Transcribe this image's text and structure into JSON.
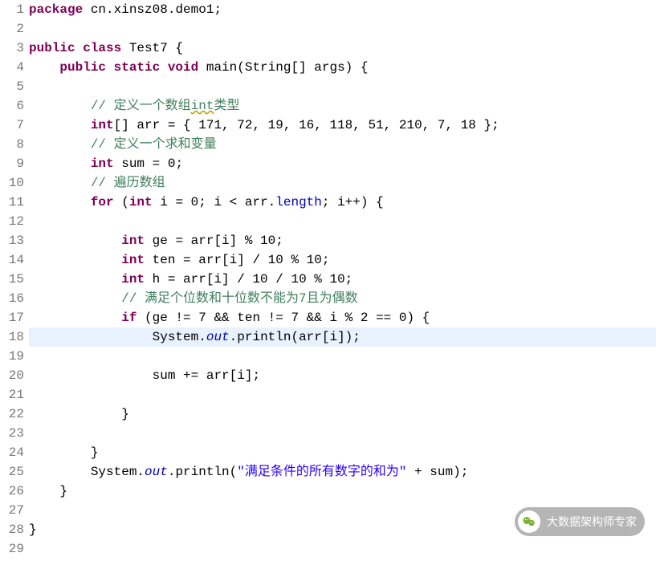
{
  "lines": [
    {
      "n": 1,
      "t": [
        [
          "kw",
          "package"
        ],
        [
          "",
          " cn.xinsz08.demo1;"
        ]
      ]
    },
    {
      "n": 2,
      "t": [
        [
          "",
          ""
        ]
      ]
    },
    {
      "n": 3,
      "t": [
        [
          "kw",
          "public class"
        ],
        [
          "",
          " Test7 {"
        ]
      ]
    },
    {
      "n": 4,
      "t": [
        [
          "",
          "    "
        ],
        [
          "kw",
          "public static void"
        ],
        [
          "",
          " main(String[] args) {"
        ]
      ]
    },
    {
      "n": 5,
      "t": [
        [
          "",
          ""
        ]
      ]
    },
    {
      "n": 6,
      "t": [
        [
          "",
          "        "
        ],
        [
          "cmt",
          "// 定义一个数组"
        ],
        [
          "cmtkw",
          "int"
        ],
        [
          "cmt",
          "类型"
        ]
      ]
    },
    {
      "n": 7,
      "t": [
        [
          "",
          "        "
        ],
        [
          "kw",
          "int"
        ],
        [
          "",
          "[] arr = { 171, 72, 19, 16, 118, 51, 210, 7, 18 };"
        ]
      ]
    },
    {
      "n": 8,
      "t": [
        [
          "",
          "        "
        ],
        [
          "cmt",
          "// 定义一个求和变量"
        ]
      ]
    },
    {
      "n": 9,
      "t": [
        [
          "",
          "        "
        ],
        [
          "kw",
          "int"
        ],
        [
          "",
          " sum = 0;"
        ]
      ]
    },
    {
      "n": 10,
      "t": [
        [
          "",
          "        "
        ],
        [
          "cmt",
          "// 遍历数组"
        ]
      ]
    },
    {
      "n": 11,
      "t": [
        [
          "",
          "        "
        ],
        [
          "kw",
          "for"
        ],
        [
          "",
          " ("
        ],
        [
          "kw",
          "int"
        ],
        [
          "",
          " i = 0; i < arr."
        ],
        [
          "fld",
          "length"
        ],
        [
          "",
          "; i++) {"
        ]
      ]
    },
    {
      "n": 12,
      "t": [
        [
          "",
          ""
        ]
      ]
    },
    {
      "n": 13,
      "t": [
        [
          "",
          "            "
        ],
        [
          "kw",
          "int"
        ],
        [
          "",
          " ge = arr[i] % 10;"
        ]
      ]
    },
    {
      "n": 14,
      "t": [
        [
          "",
          "            "
        ],
        [
          "kw",
          "int"
        ],
        [
          "",
          " ten = arr[i] / 10 % 10;"
        ]
      ]
    },
    {
      "n": 15,
      "t": [
        [
          "",
          "            "
        ],
        [
          "kw",
          "int"
        ],
        [
          "",
          " h = arr[i] / 10 / 10 % 10;"
        ]
      ]
    },
    {
      "n": 16,
      "t": [
        [
          "",
          "            "
        ],
        [
          "cmt",
          "// 满足个位数和十位数不能为7且为偶数"
        ]
      ]
    },
    {
      "n": 17,
      "t": [
        [
          "",
          "            "
        ],
        [
          "kw",
          "if"
        ],
        [
          "",
          " (ge != 7 && ten != 7 && i % 2 == 0) {"
        ]
      ]
    },
    {
      "n": 18,
      "hl": true,
      "t": [
        [
          "",
          "                System."
        ],
        [
          "sf",
          "out"
        ],
        [
          "",
          ".println(arr[i]);"
        ]
      ]
    },
    {
      "n": 19,
      "t": [
        [
          "",
          ""
        ]
      ]
    },
    {
      "n": 20,
      "t": [
        [
          "",
          "                sum += arr[i];"
        ]
      ]
    },
    {
      "n": 21,
      "t": [
        [
          "",
          ""
        ]
      ]
    },
    {
      "n": 22,
      "t": [
        [
          "",
          "            }"
        ]
      ]
    },
    {
      "n": 23,
      "t": [
        [
          "",
          ""
        ]
      ]
    },
    {
      "n": 24,
      "t": [
        [
          "",
          "        }"
        ]
      ]
    },
    {
      "n": 25,
      "t": [
        [
          "",
          "        System."
        ],
        [
          "sf",
          "out"
        ],
        [
          "",
          ".println("
        ],
        [
          "str",
          "\"满足条件的所有数字的和为\""
        ],
        [
          "",
          " + sum);"
        ]
      ]
    },
    {
      "n": 26,
      "t": [
        [
          "",
          "    }"
        ]
      ]
    },
    {
      "n": 27,
      "t": [
        [
          "",
          ""
        ]
      ]
    },
    {
      "n": 28,
      "t": [
        [
          "",
          "}"
        ]
      ]
    },
    {
      "n": 29,
      "t": [
        [
          "",
          ""
        ]
      ]
    }
  ],
  "watermark": "大数据架构师专家"
}
